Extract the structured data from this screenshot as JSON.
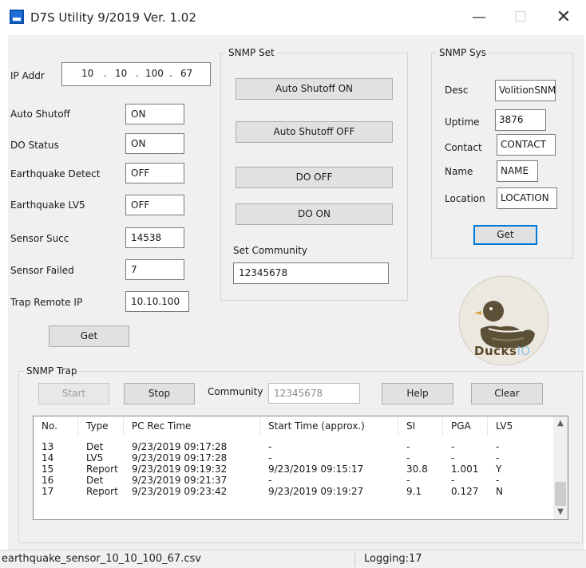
{
  "window": {
    "title": "D7S Utility 9/2019 Ver. 1.02",
    "minimize": "—",
    "maximize": "☐",
    "close": "✕"
  },
  "device": {
    "ip_label": "IP Addr",
    "ip": [
      "10",
      "10",
      "100",
      "67"
    ],
    "fields": [
      {
        "label": "Auto Shutoff",
        "value": "ON"
      },
      {
        "label": "DO Status",
        "value": "ON"
      },
      {
        "label": "Earthquake Detect",
        "value": "OFF"
      },
      {
        "label": "Earthquake LV5",
        "value": "OFF"
      },
      {
        "label": "Sensor Succ",
        "value": "14538"
      },
      {
        "label": "Sensor Failed",
        "value": "7"
      },
      {
        "label": "Trap Remote IP",
        "value": "10.10.100"
      }
    ],
    "get_button": "Get"
  },
  "snmp_set": {
    "title": "SNMP Set",
    "buttons": [
      "Auto Shutoff ON",
      "Auto Shutoff OFF",
      "DO OFF",
      "DO ON"
    ],
    "community_label": "Set Community",
    "community_value": "12345678"
  },
  "snmp_sys": {
    "title": "SNMP Sys",
    "fields": [
      {
        "label": "Desc",
        "value": "VolitionSNMP"
      },
      {
        "label": "Uptime",
        "value": "3876"
      },
      {
        "label": "Contact",
        "value": "CONTACT"
      },
      {
        "label": "Name",
        "value": "NAME"
      },
      {
        "label": "Location",
        "value": "LOCATION"
      }
    ],
    "get_button": "Get"
  },
  "logo": {
    "brand": "Ducks",
    "suffix": "IO"
  },
  "snmp_trap": {
    "title": "SNMP Trap",
    "start": "Start",
    "stop": "Stop",
    "community_label": "Community",
    "community_value": "12345678",
    "help": "Help",
    "clear": "Clear",
    "columns": [
      "No.",
      "Type",
      "PC Rec Time",
      "Start Time (approx.)",
      "SI",
      "PGA",
      "LV5"
    ],
    "rows": [
      [
        "13",
        "Det",
        "9/23/2019 09:17:28",
        "-",
        "-",
        "-",
        "-"
      ],
      [
        "14",
        "LV5",
        "9/23/2019 09:17:28",
        "-",
        "-",
        "-",
        "-"
      ],
      [
        "15",
        "Report",
        "9/23/2019 09:19:32",
        "9/23/2019 09:15:17",
        "30.8",
        "1.001",
        "Y"
      ],
      [
        "16",
        "Det",
        "9/23/2019 09:21:37",
        "-",
        "-",
        "-",
        "-"
      ],
      [
        "17",
        "Report",
        "9/23/2019 09:23:42",
        "9/23/2019 09:19:27",
        "9.1",
        "0.127",
        "N"
      ]
    ]
  },
  "status": {
    "file": "earthquake_sensor_10_10_100_67.csv",
    "logging": "Logging:17"
  },
  "colors": {
    "window_bg": "#f0f0f0",
    "title_icon": "#1e6fd9",
    "focus_border": "#0078d7"
  }
}
